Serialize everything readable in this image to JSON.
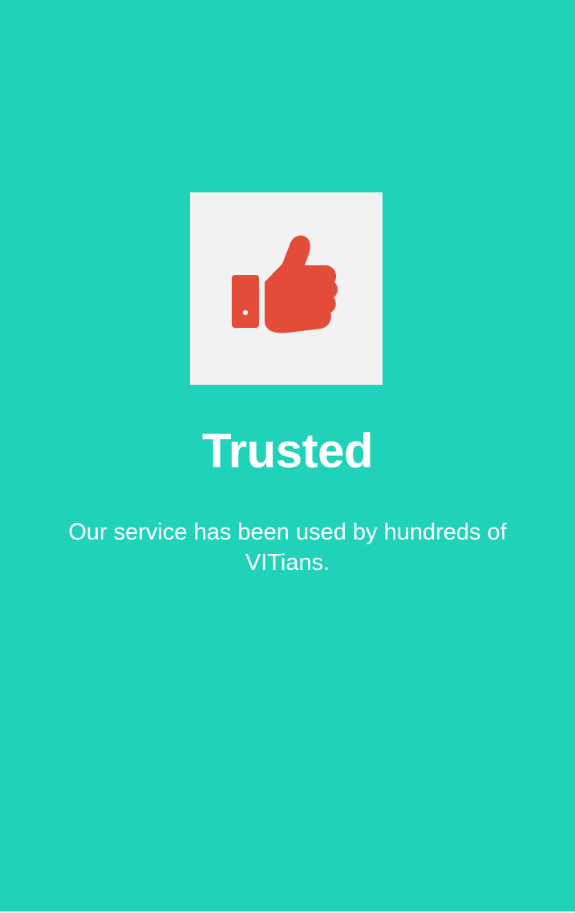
{
  "onboarding": {
    "icon": "thumbs-up-icon",
    "title": "Trusted",
    "description": "Our service has been used by hundreds of VITians."
  },
  "colors": {
    "background": "#21d2ba",
    "card": "#f3f2f2",
    "icon": "#e24c38",
    "text": "#ffffff"
  }
}
